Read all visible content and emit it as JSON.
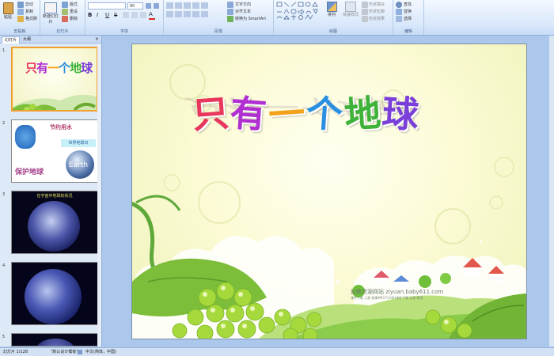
{
  "ribbon": {
    "clipboard": {
      "paste_label": "粘贴",
      "cut_label": "剪切",
      "copy_label": "复制",
      "format_painter_label": "格式刷",
      "group_label": "剪贴板"
    },
    "slides": {
      "new_slide_label": "新建幻灯片",
      "layout_label": "版式",
      "reset_label": "重设",
      "delete_label": "删除",
      "group_label": "幻灯片"
    },
    "font": {
      "size_value": "80",
      "group_label": "字体"
    },
    "paragraph": {
      "text_direction_label": "文字方向",
      "align_text_label": "对齐文本",
      "smartart_label": "转换为 SmartArt",
      "group_label": "段落"
    },
    "drawing": {
      "arrange_label": "排列",
      "quick_styles_label": "快速样式",
      "fill_label": "形状填充",
      "outline_label": "形状轮廓",
      "effects_label": "形状效果",
      "group_label": "绘图"
    },
    "editing": {
      "find_label": "查找",
      "replace_label": "替换",
      "select_label": "选择",
      "group_label": "编辑"
    }
  },
  "panel": {
    "tab_slides": "幻灯片",
    "tab_outline": "大纲",
    "slide_numbers": [
      "1",
      "2",
      "3",
      "4",
      "5"
    ]
  },
  "thumb2": {
    "title_text": "节约用水",
    "label_text": "世界地球日",
    "bottom_text": "保护地球",
    "earth_text": "Earth"
  },
  "thumb3": {
    "title_text": "在宇宙中地球的状况"
  },
  "slide": {
    "title": "只有一个地球",
    "watermark_line1": "幼教资源网站  ziyuan.baby611.com",
    "watermark_line2": "课件下载  儿歌  故事MP3  FLASH课件下载  试卷  教案"
  },
  "status": {
    "slide_info": "幻灯片 1/128",
    "theme": "\"默认设计模板\"",
    "language": "中文(简体，中国)"
  },
  "colors": {
    "title_colors": [
      "#e8365c",
      "#b02fd0",
      "#f2a21c",
      "#2a8fe0",
      "#3fb23a",
      "#7a3fd8"
    ]
  }
}
